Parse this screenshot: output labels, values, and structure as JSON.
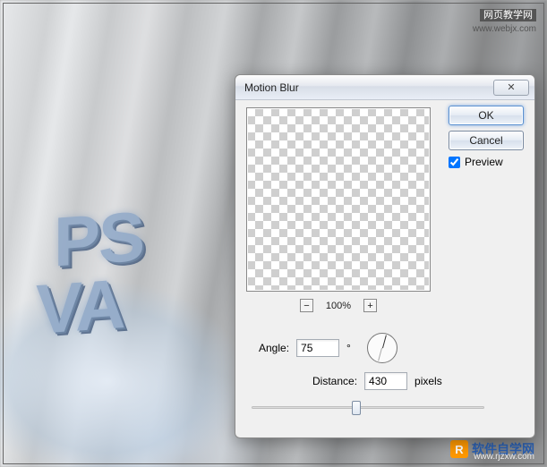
{
  "watermark_top": {
    "cn": "网页教学网",
    "url": "www.webjx.com"
  },
  "watermark_bottom": {
    "badge": "R",
    "cn": "软件自学网",
    "url": "www.rjzxw.com"
  },
  "bg_text": {
    "line1": "PS",
    "line2": "VA"
  },
  "dialog": {
    "title": "Motion Blur",
    "close_glyph": "✕",
    "ok": "OK",
    "cancel": "Cancel",
    "preview_label": "Preview",
    "preview_checked": true,
    "zoom": {
      "minus": "−",
      "plus": "+",
      "level": "100%"
    },
    "angle": {
      "label": "Angle:",
      "value": "75",
      "unit": "°"
    },
    "distance": {
      "label": "Distance:",
      "value": "430",
      "unit": "pixels"
    }
  }
}
